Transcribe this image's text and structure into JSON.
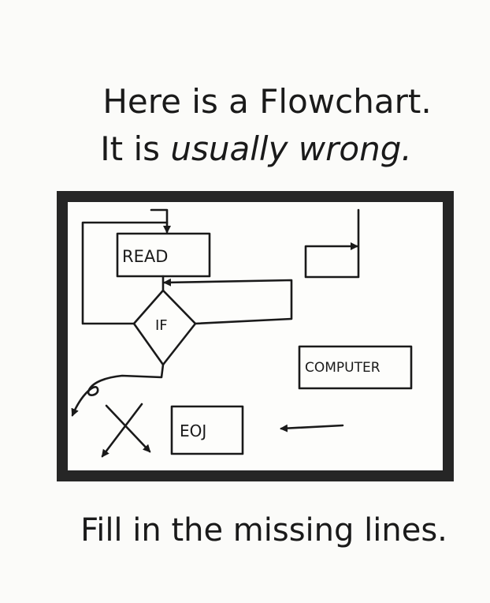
{
  "title": {
    "line1": "Here is a Flowchart.",
    "line2_prefix": "It is ",
    "line2_em": "usually wrong."
  },
  "diagram": {
    "nodes": {
      "read": "READ",
      "if": "IF",
      "computer": "COMPUTER",
      "eoj": "EOJ"
    }
  },
  "caption": "Fill in the missing lines.",
  "colors": {
    "ink": "#1a1a1a",
    "frame": "#262626",
    "paper": "#fbfbf9"
  }
}
